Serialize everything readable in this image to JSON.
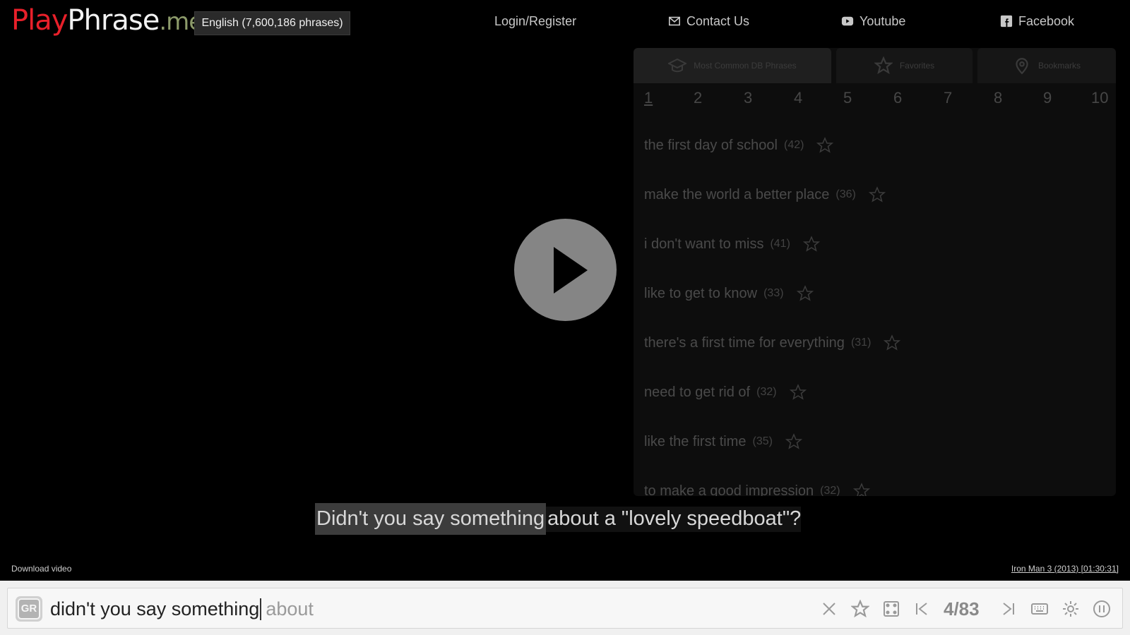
{
  "header": {
    "logo": {
      "part1": "Play",
      "part2": "Phrase",
      "part3": ".me"
    },
    "language_button": "English (7,600,186 phrases)",
    "nav": {
      "login": "Login/Register",
      "contact": "Contact Us",
      "youtube": "Youtube",
      "facebook": "Facebook"
    }
  },
  "panel": {
    "tabs": [
      {
        "label": "Most Common DB Phrases",
        "icon": "graduation-cap-icon",
        "active": true
      },
      {
        "label": "Favorites",
        "icon": "star-icon",
        "active": false
      },
      {
        "label": "Bookmarks",
        "icon": "map-pin-icon",
        "active": false
      }
    ],
    "pages": [
      "1",
      "2",
      "3",
      "4",
      "5",
      "6",
      "7",
      "8",
      "9",
      "10"
    ],
    "current_page": "1",
    "phrases": [
      {
        "text": "the first day of school",
        "count": "(42)"
      },
      {
        "text": "make the world a better place",
        "count": "(36)"
      },
      {
        "text": "i don't want to miss",
        "count": "(41)"
      },
      {
        "text": "like to get to know",
        "count": "(33)"
      },
      {
        "text": "there's a first time for everything",
        "count": "(31)"
      },
      {
        "text": "need to get rid of",
        "count": "(32)"
      },
      {
        "text": "like the first time",
        "count": "(35)"
      },
      {
        "text": "to make a good impression",
        "count": "(32)"
      }
    ]
  },
  "player": {
    "subtitle_highlight": "Didn't you say something",
    "subtitle_rest": "about a \"lovely speedboat\"?",
    "download_label": "Download video",
    "movie_label": "Iron Man 3 (2013) [01:30:31]"
  },
  "search": {
    "badge": "GR",
    "typed": "didn't you say something",
    "suggestion": "about",
    "counter": "4/83"
  },
  "colors": {
    "logo_play": "#e8202a",
    "logo_me": "#8c9a6a",
    "background": "#000000",
    "search_bar": "#f0f0f0"
  }
}
